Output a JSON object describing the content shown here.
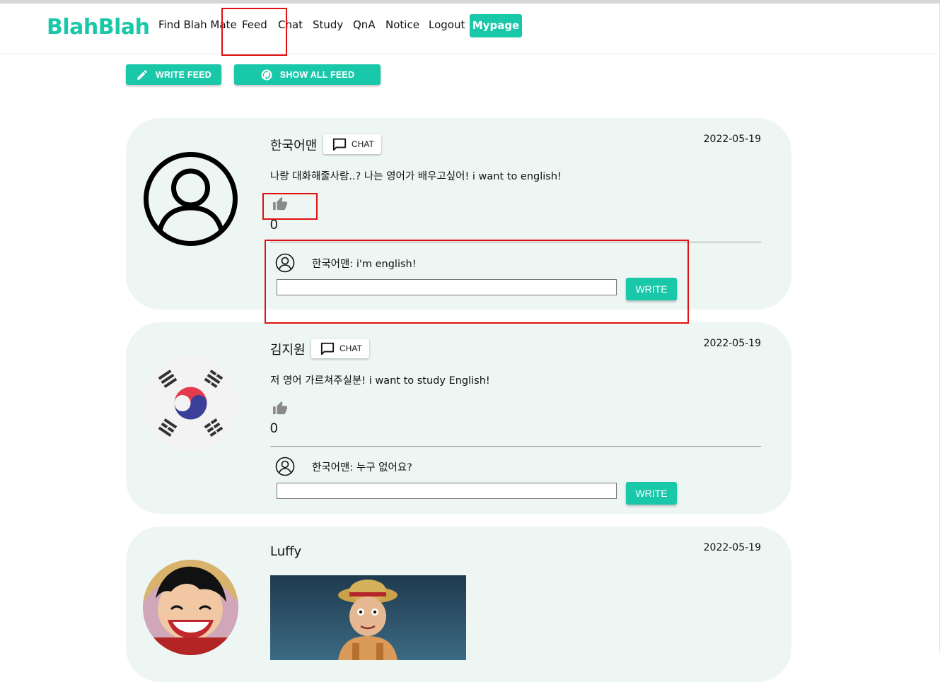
{
  "header": {
    "logo": "BlahBlah",
    "nav": [
      "Find Blah Mate",
      "Feed",
      "Chat",
      "Study",
      "QnA",
      "Notice",
      "Logout"
    ],
    "mypage_label": "Mypage"
  },
  "actions": {
    "write_feed": "WRITE FEED",
    "show_all_feed": "SHOW ALL FEED"
  },
  "colors": {
    "accent": "#19c7a9",
    "card_bg": "#edf6f3",
    "annotation": "#e01010"
  },
  "feeds": [
    {
      "author": "한국어맨",
      "chat_label": "CHAT",
      "date": "2022-05-19",
      "content": "나랑 대화해줄사람..? 나는 영어가 배우고싶어! i want to english!",
      "likes": "0",
      "comment": "한국어맨: i'm english!",
      "write_label": "WRITE",
      "avatar_icon": "default-user-icon"
    },
    {
      "author": "김지원",
      "chat_label": "CHAT",
      "date": "2022-05-19",
      "content": "저 영어 가르쳐주실분! i want to study English!",
      "likes": "0",
      "comment": "한국어맨: 누구 없어요?",
      "write_label": "WRITE",
      "avatar_icon": "korean-flag-icon"
    },
    {
      "author": "Luffy",
      "date": "2022-05-19",
      "avatar_icon": "luffy-avatar"
    }
  ]
}
